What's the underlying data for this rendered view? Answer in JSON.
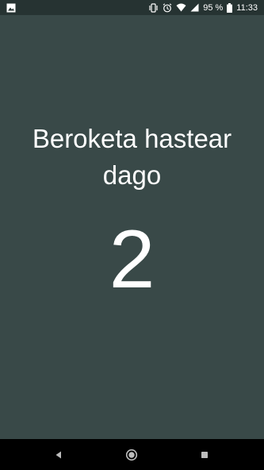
{
  "status_bar": {
    "battery_percent": "95 %",
    "time": "11:33",
    "icons": [
      "image-icon",
      "vibrate-icon",
      "alarm-icon",
      "wifi-icon",
      "signal-icon",
      "battery-icon"
    ]
  },
  "main": {
    "heading": "Beroketa hastear dago",
    "countdown": "2"
  },
  "nav_bar": {
    "icons": [
      "back-icon",
      "home-icon",
      "recents-icon"
    ]
  },
  "colors": {
    "background": "#394948",
    "status_bar": "#263332",
    "nav_bar": "#000000",
    "text": "#ffffff"
  }
}
